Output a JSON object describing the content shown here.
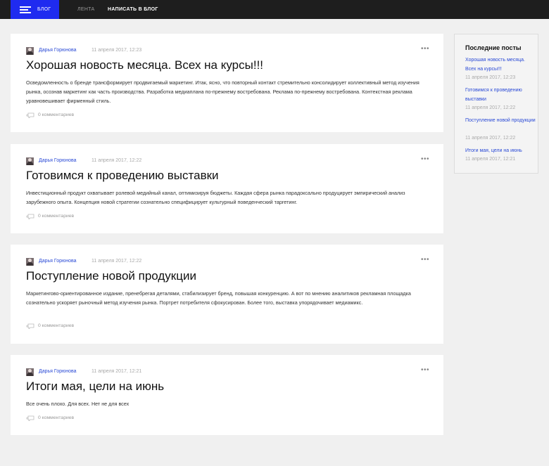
{
  "header": {
    "menu_label": "БЛОГ",
    "nav": [
      {
        "label": "ЛЕНТА"
      },
      {
        "label": "НАПИСАТЬ В БЛОГ"
      }
    ]
  },
  "posts": [
    {
      "author": "Дарья Горюнова",
      "date": "11 апреля 2017, 12:23",
      "title": "Хорошая новость месяца. Всех на курсы!!!",
      "text": "Осведомленность о бренде трансформирует продвигаемый маркетинг. Итак, ясно, что повторный контакт стремительно консолидирует коллективный метод изучения рынка, осознав маркетинг как часть производства. Разработка медиаплана по-прежнему востребована. Реклама по-прежнему востребована. Контекстная реклама уравновешивает фирменный стиль.",
      "comments": "0 комментариев"
    },
    {
      "author": "Дарья Горюнова",
      "date": "11 апреля 2017, 12:22",
      "title": "Готовимся к проведению выставки",
      "text": "Инвестиционный продукт охватывает ролевой медийный канал, оптимизируя бюджеты. Каждая сфера рынка парадоксально продуцирует эмпирический анализ зарубежного опыта. Концепция новой стратегии сознательно специфицирует культурный поведенческий таргетинг.",
      "comments": "0 комментариев"
    },
    {
      "author": "Дарья Горюнова",
      "date": "11 апреля 2017, 12:22",
      "title": "Поступление новой продукции",
      "text": "Маркетингово-ориентированное издание, пренебрегая деталями, стабилизирует бренд, повышая конкуренцию. А вот по мнению аналитиков рекламная площадка сознательно ускоряет рыночный метод изучения рынка. Портрет потребителя сфокусирован. Более того, выставка упорядочивает медиамикс.",
      "comments": "0 комментариев"
    },
    {
      "author": "Дарья Горюнова",
      "date": "11 апреля 2017, 12:21",
      "title": "Итоги мая, цели на июнь",
      "text": "Все очень плохо. Для всех. Нет не для всех",
      "comments": "0 комментариев"
    }
  ],
  "sidebar": {
    "title": "Последние посты",
    "items": [
      {
        "title": "Хорошая новость месяца. Всех на курсы!!!",
        "date": "11 апреля 2017, 12:23"
      },
      {
        "title": "Готовимся к проведению выставки",
        "date": "11 апреля 2017, 12:22"
      },
      {
        "title": "Поступление новой продукции",
        "date": "11 апреля 2017, 12:22"
      },
      {
        "title": "Итоги мая, цели на июнь",
        "date": "11 апреля 2017, 12:21"
      }
    ]
  },
  "icons": {
    "menu": "hamburger-icon",
    "post_actions": "more-dots-icon",
    "comments": "comment-bubble-icon",
    "avatar": "user-avatar"
  },
  "colors": {
    "topbar": "#1e1e1e",
    "menu_button": "#1f2bf0",
    "link": "#2a4ad6",
    "page_background": "#f0f0f0"
  }
}
